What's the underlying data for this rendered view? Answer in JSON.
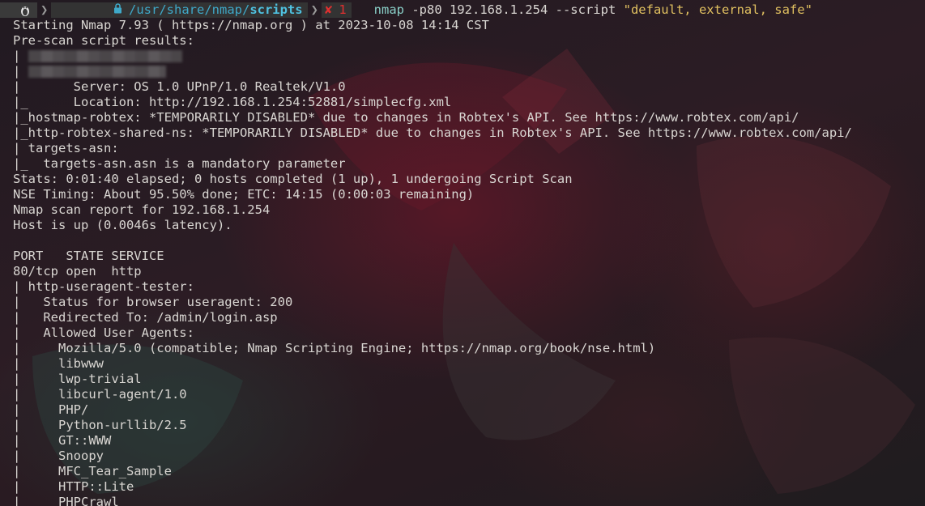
{
  "prompt": {
    "os_icon": "linux-penguin-icon",
    "lock_icon": "lock-icon",
    "path_prefix": "/usr/share/nmap/",
    "path_current": "scripts",
    "status_mark": "✘",
    "exit_code": "1",
    "command_name": "nmap",
    "command_args": " -p80 192.168.1.254 --script ",
    "command_string": "\"default, external, safe\""
  },
  "output_lines": [
    "Starting Nmap 7.93 ( https://nmap.org ) at 2023-10-08 14:14 CST",
    "Pre-scan script results:",
    "| ",
    "| ",
    "|       Server: OS 1.0 UPnP/1.0 Realtek/V1.0",
    "|_      Location: http://192.168.1.254:52881/simplecfg.xml",
    "|_hostmap-robtex: *TEMPORARILY DISABLED* due to changes in Robtex's API. See https://www.robtex.com/api/",
    "|_http-robtex-shared-ns: *TEMPORARILY DISABLED* due to changes in Robtex's API. See https://www.robtex.com/api/",
    "| targets-asn:",
    "|_  targets-asn.asn is a mandatory parameter",
    "Stats: 0:01:40 elapsed; 0 hosts completed (1 up), 1 undergoing Script Scan",
    "NSE Timing: About 95.50% done; ETC: 14:15 (0:00:03 remaining)",
    "Nmap scan report for 192.168.1.254",
    "Host is up (0.0046s latency).",
    "",
    "PORT   STATE SERVICE",
    "80/tcp open  http",
    "| http-useragent-tester:",
    "|   Status for browser useragent: 200",
    "|   Redirected To: /admin/login.asp",
    "|   Allowed User Agents:",
    "|     Mozilla/5.0 (compatible; Nmap Scripting Engine; https://nmap.org/book/nse.html)",
    "|     libwww",
    "|     lwp-trivial",
    "|     libcurl-agent/1.0",
    "|     PHP/",
    "|     Python-urllib/2.5",
    "|     GT::WWW",
    "|     Snoopy",
    "|     MFC_Tear_Sample",
    "|     HTTP::Lite",
    "|     PHPCrawl"
  ],
  "colors": {
    "text": "#d9d6d2",
    "path": "#3fa9c9",
    "error": "#e03030",
    "command": "#8ad0c8",
    "string": "#e0c060"
  }
}
